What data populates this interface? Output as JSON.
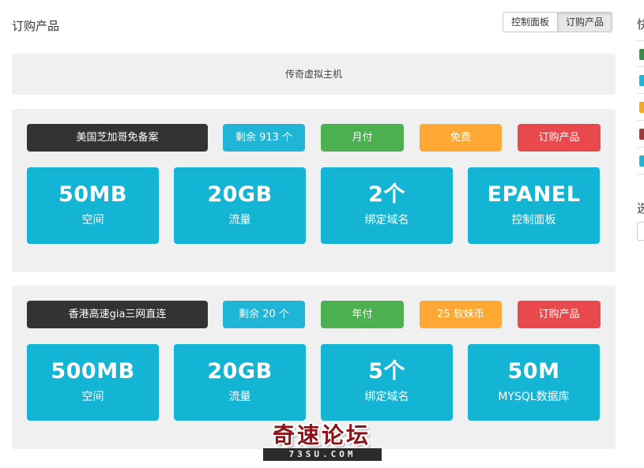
{
  "page": {
    "title": "订购产品"
  },
  "header": {
    "segments": [
      {
        "label": "控制面板",
        "active": false
      },
      {
        "label": "订购产品",
        "active": true
      }
    ]
  },
  "category": {
    "label": "传奇虚拟主机"
  },
  "products": [
    {
      "name": "美国芝加哥免备案",
      "stock": "剩余 913 个",
      "cycle": "月付",
      "price": "免费",
      "order_label": "订购产品",
      "stats": [
        {
          "value": "50MB",
          "label": "空间"
        },
        {
          "value": "20GB",
          "label": "流量"
        },
        {
          "value": "2个",
          "label": "绑定域名"
        },
        {
          "value": "EPANEL",
          "label": "控制面板"
        }
      ]
    },
    {
      "name": "香港高速gia三网直连",
      "stock": "剩余 20 个",
      "cycle": "年付",
      "price": "25 软妹币",
      "order_label": "订购产品",
      "stats": [
        {
          "value": "500MB",
          "label": "空间"
        },
        {
          "value": "20GB",
          "label": "流量"
        },
        {
          "value": "5个",
          "label": "绑定域名"
        },
        {
          "value": "50M",
          "label": "MYSQL数据库"
        }
      ]
    }
  ],
  "sidebar": {
    "title": "快",
    "title2": "选",
    "chip_colors": [
      "#3c8a4e",
      "#1fb5d6",
      "#f5a623",
      "#9c3b3b",
      "#1fb5d6"
    ]
  },
  "watermark": {
    "main": "奇速论坛",
    "sub": "73SU.COM"
  },
  "colors": {
    "name_tag": "#333333",
    "stock_tag": "#1fb5d6",
    "cycle_tag": "#4caf50",
    "price_tag": "#ffa834",
    "order_tag": "#e9494c",
    "stat_box": "#14b4d4"
  }
}
